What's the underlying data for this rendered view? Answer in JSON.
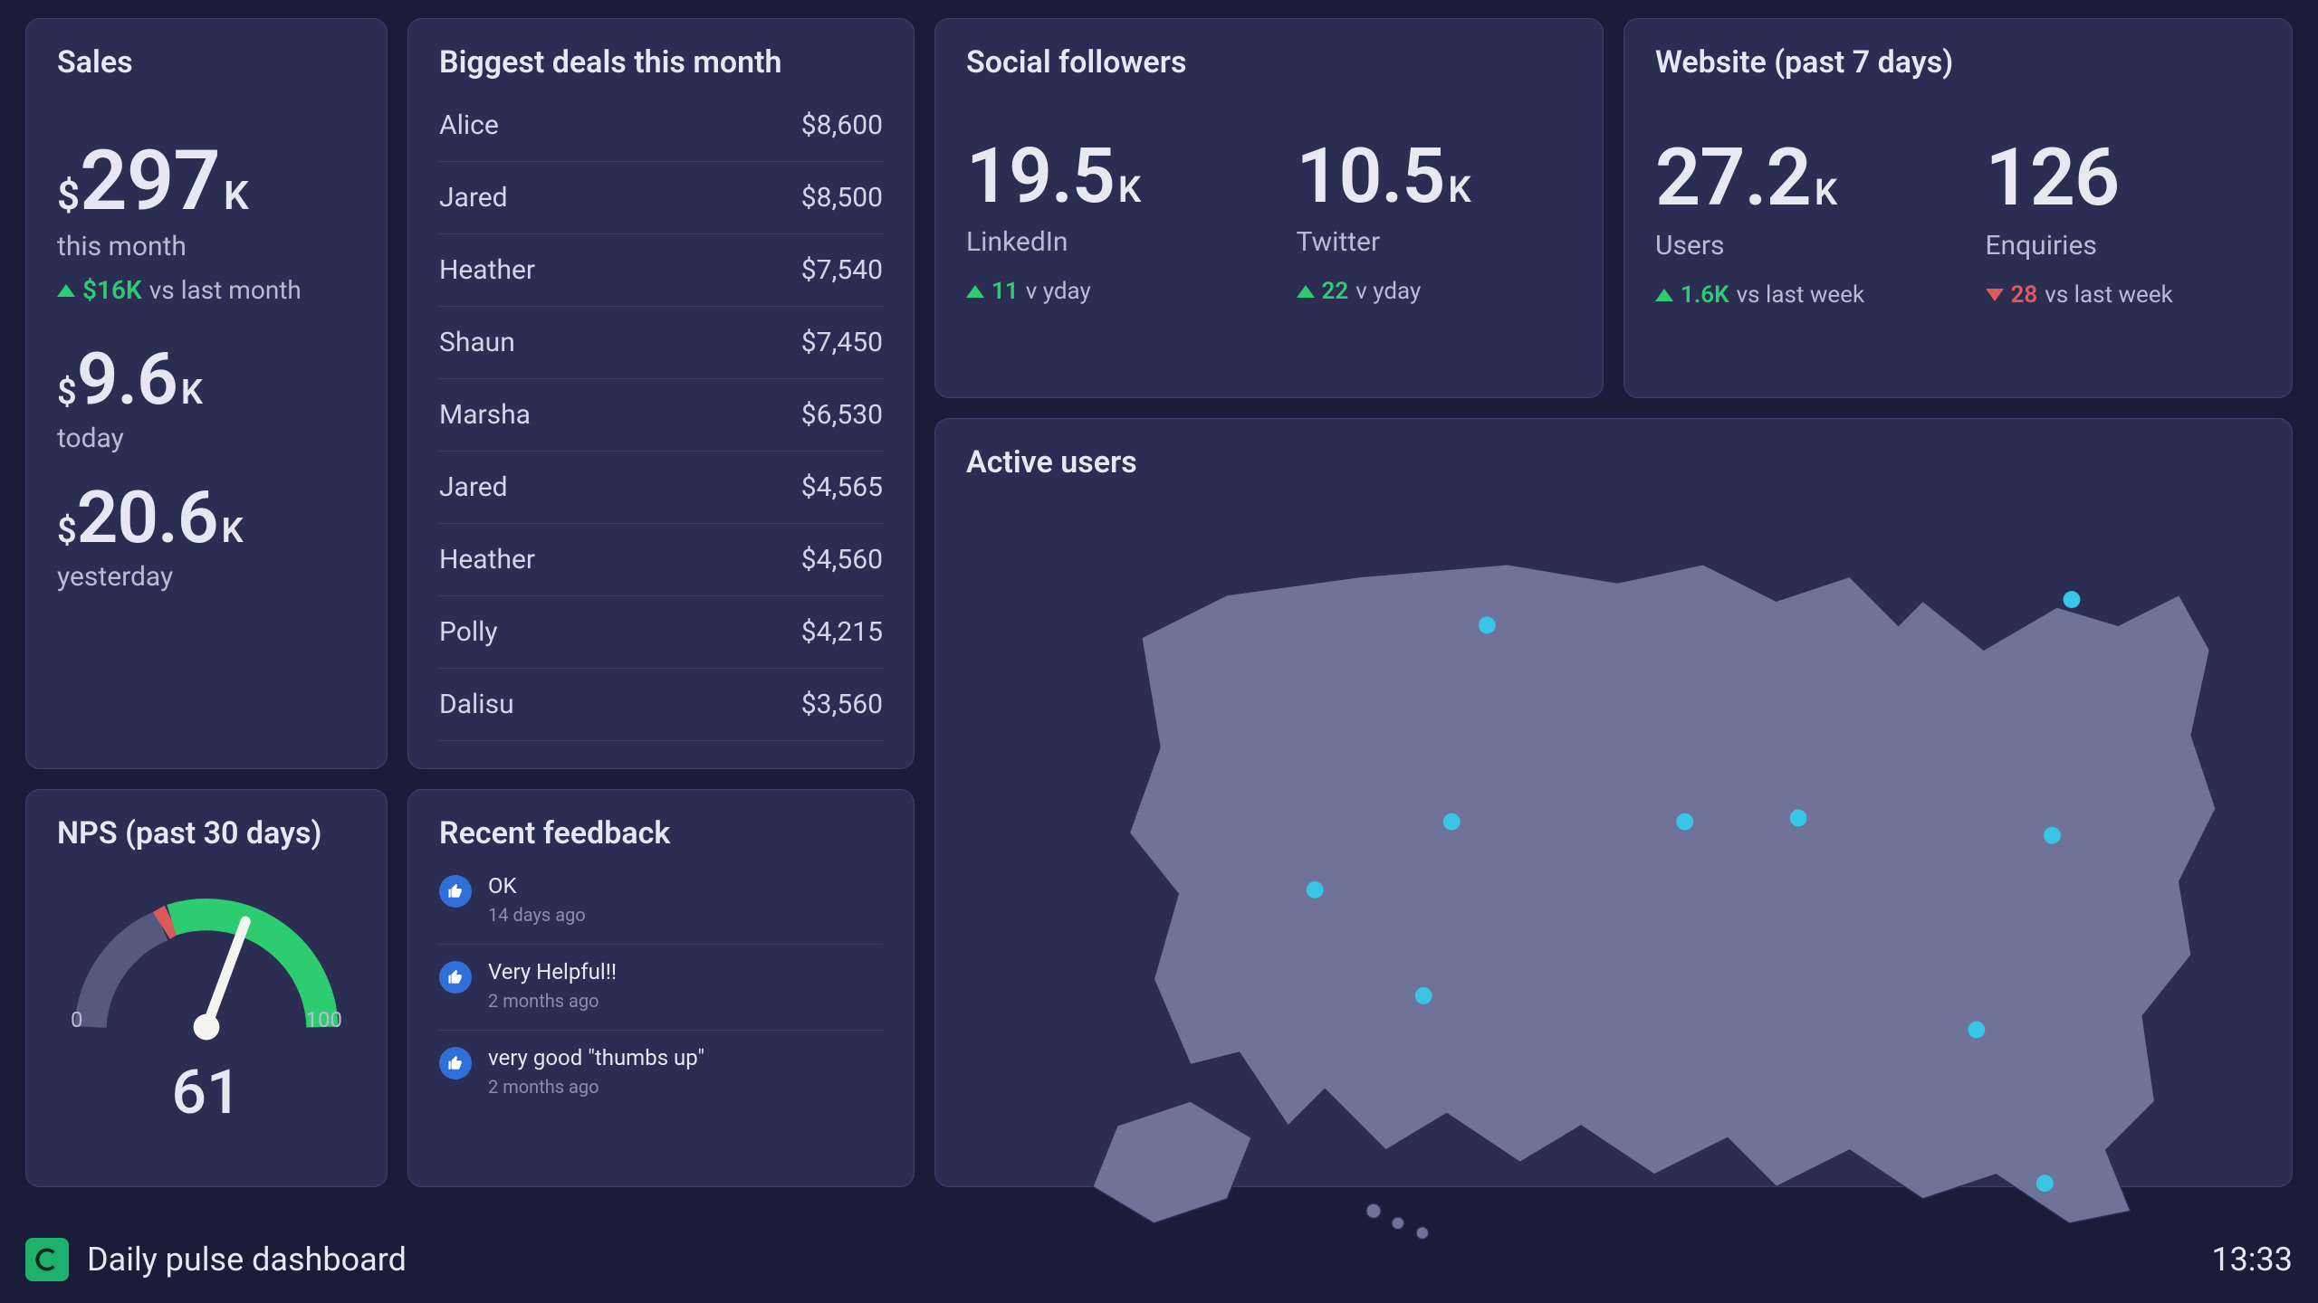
{
  "footer": {
    "title": "Daily pulse dashboard",
    "time": "13:33"
  },
  "sales": {
    "title": "Sales",
    "month": {
      "prefix": "$",
      "value": "297",
      "suffix": "K",
      "label": "this month",
      "delta_value": "$16K",
      "delta_text": "vs last month",
      "direction": "up"
    },
    "today": {
      "prefix": "$",
      "value": "9.6",
      "suffix": "K",
      "label": "today"
    },
    "yesterday": {
      "prefix": "$",
      "value": "20.6",
      "suffix": "K",
      "label": "yesterday"
    }
  },
  "deals": {
    "title": "Biggest deals this month",
    "rows": [
      {
        "name": "Alice",
        "amount": "$8,600"
      },
      {
        "name": "Jared",
        "amount": "$8,500"
      },
      {
        "name": "Heather",
        "amount": "$7,540"
      },
      {
        "name": "Shaun",
        "amount": "$7,450"
      },
      {
        "name": "Marsha",
        "amount": "$6,530"
      },
      {
        "name": "Jared",
        "amount": "$4,565"
      },
      {
        "name": "Heather",
        "amount": "$4,560"
      },
      {
        "name": "Polly",
        "amount": "$4,215"
      },
      {
        "name": "Dalisu",
        "amount": "$3,560"
      }
    ]
  },
  "social": {
    "title": "Social followers",
    "linkedin": {
      "value": "19.5",
      "suffix": "K",
      "label": "LinkedIn",
      "delta_value": "11",
      "delta_text": "v yday",
      "direction": "up"
    },
    "twitter": {
      "value": "10.5",
      "suffix": "K",
      "label": "Twitter",
      "delta_value": "22",
      "delta_text": "v yday",
      "direction": "up"
    }
  },
  "website": {
    "title": "Website (past 7 days)",
    "users": {
      "value": "27.2",
      "suffix": "K",
      "label": "Users",
      "delta_value": "1.6K",
      "delta_text": "vs last week",
      "direction": "up"
    },
    "enquiries": {
      "value": "126",
      "suffix": "",
      "label": "Enquiries",
      "delta_value": "28",
      "delta_text": "vs last week",
      "direction": "down"
    }
  },
  "nps": {
    "title": "NPS (past 30 days)",
    "score": "61",
    "scale_min": "0",
    "scale_max": "100"
  },
  "feedback": {
    "title": "Recent feedback",
    "items": [
      {
        "text": "OK",
        "time": "14 days ago"
      },
      {
        "text": "Very Helpful!!",
        "time": "2 months ago"
      },
      {
        "text": "very good \"thumbs up\"",
        "time": "2 months ago"
      }
    ]
  },
  "map": {
    "title": "Active users",
    "points": [
      {
        "x": 0.363,
        "y": 0.177
      },
      {
        "x": 0.842,
        "y": 0.143
      },
      {
        "x": 0.334,
        "y": 0.437
      },
      {
        "x": 0.525,
        "y": 0.437
      },
      {
        "x": 0.618,
        "y": 0.432
      },
      {
        "x": 0.826,
        "y": 0.455
      },
      {
        "x": 0.222,
        "y": 0.527
      },
      {
        "x": 0.311,
        "y": 0.667
      },
      {
        "x": 0.764,
        "y": 0.712
      },
      {
        "x": 0.82,
        "y": 0.915
      }
    ]
  },
  "chart_data": {
    "type": "gauge",
    "title": "NPS (past 30 days)",
    "value": 61,
    "range": [
      0,
      100
    ],
    "segments": [
      {
        "name": "low",
        "range": [
          0,
          32
        ],
        "color": "#55587f"
      },
      {
        "name": "marker",
        "range": [
          32,
          34
        ],
        "color": "#d85a5a"
      },
      {
        "name": "high",
        "range": [
          34,
          100
        ],
        "color": "#2ecc71"
      }
    ]
  }
}
